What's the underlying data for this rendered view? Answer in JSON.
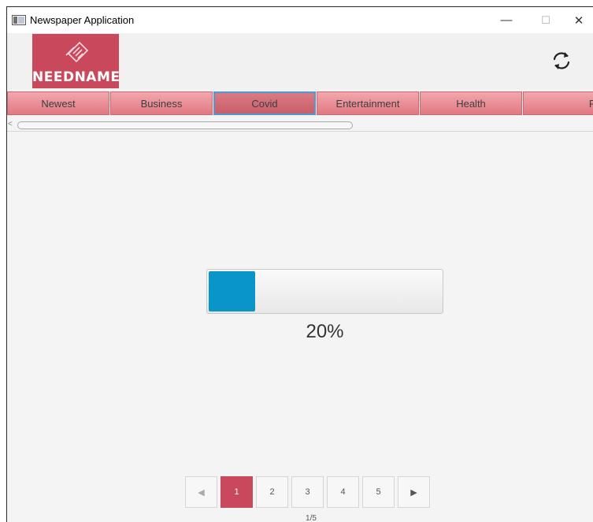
{
  "window": {
    "title": "Newspaper Application",
    "minimize_glyph": "—",
    "maximize_glyph": "☐",
    "close_glyph": "✕"
  },
  "header": {
    "logo_text": "NEEDNAME",
    "refresh_icon": "refresh-icon"
  },
  "tabs": [
    {
      "label": "Newest"
    },
    {
      "label": "Business"
    },
    {
      "label": "Covid",
      "selected": true
    },
    {
      "label": "Entertainment"
    },
    {
      "label": "Health"
    },
    {
      "label": "Politics"
    }
  ],
  "progress": {
    "value": 0.2,
    "label": "20%"
  },
  "pagination": {
    "prev_glyph": "◀",
    "next_glyph": "▶",
    "pages": [
      "1",
      "2",
      "3",
      "4",
      "5"
    ],
    "current": 1,
    "info": "1/5"
  },
  "colors": {
    "accent": "#c9485b",
    "progress": "#0a95c9",
    "tab_selected_border": "#4d9ad2"
  }
}
